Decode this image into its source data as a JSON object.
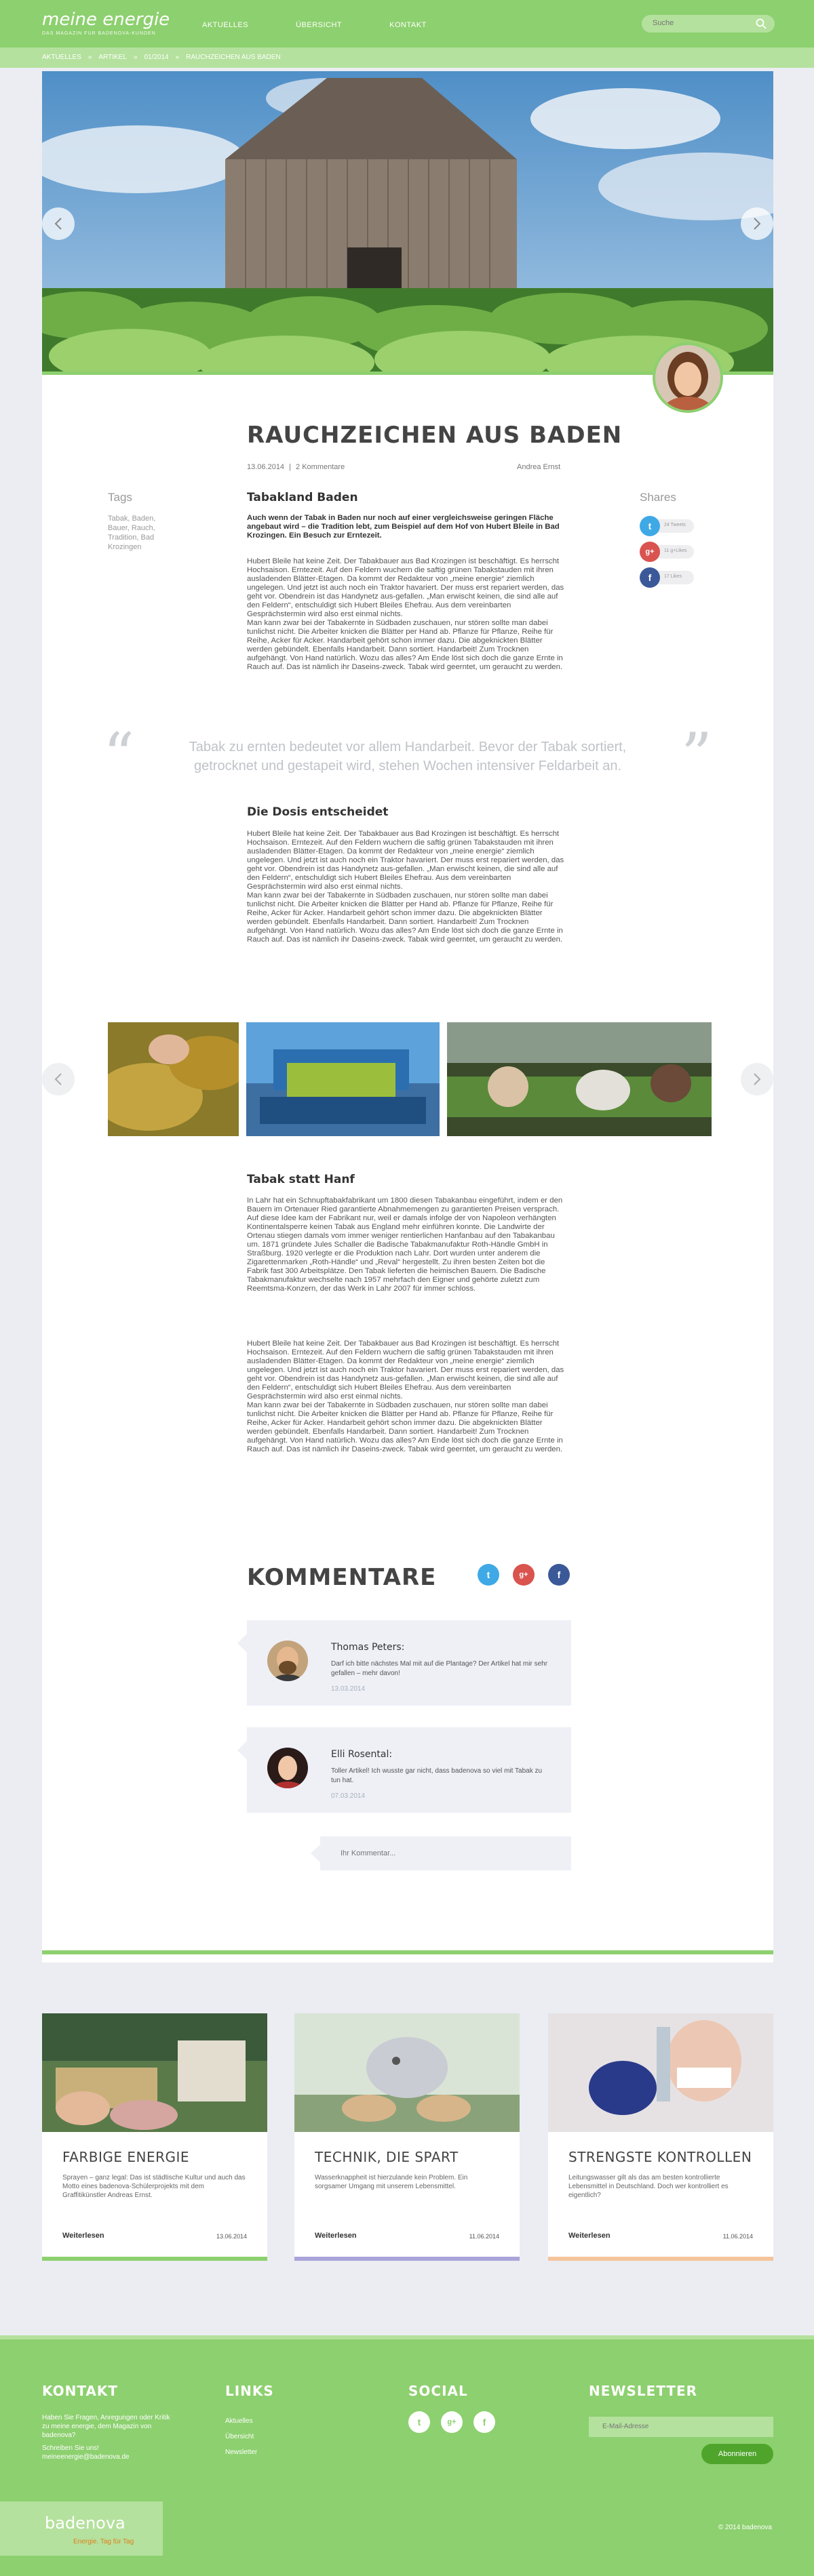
{
  "header": {
    "logo_name": "meine energie",
    "logo_tagline": "DAS MAGAZIN FÜR BADENOVA-KUNDEN",
    "nav": [
      "AKTUELLES",
      "ÜBERSICHT",
      "KONTAKT"
    ],
    "search_placeholder": "Suche"
  },
  "breadcrumb": [
    "AKTUELLES",
    "ARTIKEL",
    "01/2014",
    "RAUCHZEICHEN AUS BADEN"
  ],
  "breadcrumb_sep": "»",
  "article": {
    "title": "RAUCHZEICHEN AUS BADEN",
    "meta_date": "13.06.2014",
    "meta_sep": "|",
    "meta_comments": "2 Kommentare",
    "author": "Andrea Ernst",
    "tags_heading": "Tags",
    "tags": "Tabak, Baden, Bauer, Rauch, Tradition, Bad Krozingen",
    "shares_heading": "Shares",
    "shares": [
      {
        "network": "twitter-icon",
        "count": "24 Tweets",
        "color": "#3fa9e6",
        "glyph": "t"
      },
      {
        "network": "google-plus-icon",
        "count": "11 g+Likes",
        "color": "#d9534f",
        "glyph": "g+"
      },
      {
        "network": "facebook-icon",
        "count": "17 Likes",
        "color": "#3b5998",
        "glyph": "f"
      }
    ],
    "section1_heading": "Tabakland Baden",
    "lead": "Auch wenn der Tabak in Baden nur noch auf einer vergleichsweise geringen Fläche angebaut wird – die Tradition lebt, zum Beispiel auf dem Hof von Hubert Bleile in Bad Krozingen. Ein Besuch zur Erntezeit.",
    "body1": "Hubert Bleile hat keine Zeit. Der Tabakbauer aus Bad Krozingen ist beschäftigt. Es herrscht Hochsaison. Erntezeit. Auf den Feldern wuchern die saftig grünen Tabakstauden mit ihren ausladenden Blätter-Etagen. Da kommt der Redakteur von „meine energie“ ziemlich ungelegen. Und jetzt ist auch noch ein Traktor havariert. Der muss erst repariert werden, das geht vor. Obendrein ist das Handynetz aus-gefallen. „Man erwischt keinen, die sind alle auf den Feldern“, entschuldigt sich Hubert Bleiles Ehefrau. Aus dem vereinbarten Gesprächstermin wird also erst einmal nichts.\nMan kann zwar bei der Tabakernte in Südbaden zuschauen, nur stören sollte man dabei tunlichst nicht. Die Arbeiter knicken die Blätter per Hand ab. Pflanze für Pflanze, Reihe für Reihe, Acker für Acker. Handarbeit gehört schon immer dazu. Die abgeknickten Blätter werden gebündelt. Ebenfalls Handarbeit. Dann sortiert. Handarbeit! Zum Trocknen aufgehängt. Von Hand natürlich. Wozu das alles? Am Ende löst sich doch die ganze Ernte in Rauch auf. Das ist nämlich ihr Daseins-zweck. Tabak wird geerntet, um geraucht zu werden.",
    "quote": "Tabak zu ernten bedeutet vor allem Handarbeit. Bevor der Tabak sortiert, getrocknet und gestapeit wird, stehen Wochen intensiver Feldarbeit an.",
    "quote_open": "“",
    "quote_close": "”",
    "section2_heading": "Die Dosis entscheidet",
    "body2": "Hubert Bleile hat keine Zeit. Der Tabakbauer aus Bad Krozingen ist beschäftigt. Es herrscht Hochsaison. Erntezeit. Auf den Feldern wuchern die saftig grünen Tabakstauden mit ihren ausladenden Blätter-Etagen. Da kommt der Redakteur von „meine energie“ ziemlich ungelegen. Und jetzt ist auch noch ein Traktor havariert. Der muss erst repariert werden, das geht vor. Obendrein ist das Handynetz aus-gefallen. „Man erwischt keinen, die sind alle auf den Feldern“, entschuldigt sich Hubert Bleiles Ehefrau. Aus dem vereinbarten Gesprächstermin wird also erst einmal nichts.\nMan kann zwar bei der Tabakernte in Südbaden zuschauen, nur stören sollte man dabei tunlichst nicht. Die Arbeiter knicken die Blätter per Hand ab. Pflanze für Pflanze, Reihe für Reihe, Acker für Acker. Handarbeit gehört schon immer dazu. Die abgeknickten Blätter werden gebündelt. Ebenfalls Handarbeit. Dann sortiert. Handarbeit! Zum Trocknen aufgehängt. Von Hand natürlich. Wozu das alles? Am Ende löst sich doch die ganze Ernte in Rauch auf. Das ist nämlich ihr Daseins-zweck. Tabak wird geerntet, um geraucht zu werden.",
    "section3_heading": "Tabak statt Hanf",
    "body3": "In Lahr hat ein Schnupftabakfabrikant um 1800 diesen Tabakanbau eingeführt, indem er den Bauern im Ortenauer Ried garantierte Abnahmemengen zu garantierten Preisen versprach. Auf diese Idee kam der Fabrikant nur, weil er damals infolge der von Napoleon verhängten Kontinentalsperre keinen Tabak aus England mehr einführen konnte. Die Landwirte der Ortenau stiegen damals vom immer weniger rentierlichen Hanfanbau auf den Tabakanbau um. 1871 gründete Jules Schaller die Badische Tabakmanufaktur Roth-Händle GmbH in Straßburg. 1920 verlegte er die Produktion nach Lahr. Dort wurden unter anderem die Zigarettenmarken „Roth-Händle“ und „Reval“ hergestellt. Zu ihren besten Zeiten bot die Fabrik fast 300 Arbeitsplätze. Den Tabak lieferten die heimischen Bauern. Die Badische Tabakmanufaktur wechselte nach 1957 mehrfach den Eigner und gehörte zuletzt zum Reemtsma-Konzern, der das Werk in Lahr 2007 für immer schloss.",
    "body4": "Hubert Bleile hat keine Zeit. Der Tabakbauer aus Bad Krozingen ist beschäftigt. Es herrscht Hochsaison. Erntezeit. Auf den Feldern wuchern die saftig grünen Tabakstauden mit ihren ausladenden Blätter-Etagen. Da kommt der Redakteur von „meine energie“ ziemlich ungelegen. Und jetzt ist auch noch ein Traktor havariert. Der muss erst repariert werden, das geht vor. Obendrein ist das Handynetz aus-gefallen. „Man erwischt keinen, die sind alle auf den Feldern“, entschuldigt sich Hubert Bleiles Ehefrau. Aus dem vereinbarten Gesprächstermin wird also erst einmal nichts.\nMan kann zwar bei der Tabakernte in Südbaden zuschauen, nur stören sollte man dabei tunlichst nicht. Die Arbeiter knicken die Blätter per Hand ab. Pflanze für Pflanze, Reihe für Reihe, Acker für Acker. Handarbeit gehört schon immer dazu. Die abgeknickten Blätter werden gebündelt. Ebenfalls Handarbeit. Dann sortiert. Handarbeit! Zum Trocknen aufgehängt. Von Hand natürlich. Wozu das alles? Am Ende löst sich doch die ganze Ernte in Rauch auf. Das ist nämlich ihr Daseins-zweck. Tabak wird geerntet, um geraucht zu werden."
  },
  "comments": {
    "heading": "KOMMENTARE",
    "items": [
      {
        "name": "Thomas Peters:",
        "text": "Darf ich bitte nächstes Mal mit auf die Plantage? Der Artikel hat mir sehr gefallen – mehr davon!",
        "date": "13.03.2014"
      },
      {
        "name": "Elli Rosental:",
        "text": "Toller Artikel! Ich wusste gar nicht, dass badenova so viel mit Tabak zu tun hat.",
        "date": "07.03.2014"
      }
    ],
    "reply_placeholder": "Ihr Kommentar..."
  },
  "related": [
    {
      "title": "FARBIGE ENERGIE",
      "desc": "Sprayen – ganz legal: Das ist städtische Kultur und auch das Motto eines badenova-Schülerprojekts mit dem Graffitikünstler Andreas Ernst.",
      "more": "Weiterlesen",
      "date": "13.06.2014",
      "color": "#8dd06f"
    },
    {
      "title": "TECHNIK, DIE SPART",
      "desc": "Wasserknappheit ist hierzulande kein Problem. Ein sorgsamer Umgang mit unserem Lebensmittel.",
      "more": "Weiterlesen",
      "date": "11.06.2014",
      "color": "#a9a4d9"
    },
    {
      "title": "STRENGSTE KONTROLLEN",
      "desc": "Leitungswasser gilt als das am besten kontrollierte Lebensmittel in Deutschland. Doch wer kontrolliert es eigentlich?",
      "more": "Weiterlesen",
      "date": "11.06.2014",
      "color": "#f5c49a"
    }
  ],
  "footer": {
    "contact_h": "KONTAKT",
    "contact_text": "Haben Sie Fragen, Anregungen oder Kritik zu meine energie, dem Magazin von badenova?",
    "contact_write": "Schreiben Sie uns!",
    "contact_mail": "meineenergie@badenova.de",
    "links_h": "LINKS",
    "links": [
      "Aktuelles",
      "Übersicht",
      "Newsletter"
    ],
    "social_h": "SOCIAL",
    "social": [
      {
        "name": "twitter-icon",
        "glyph": "t"
      },
      {
        "name": "google-plus-icon",
        "glyph": "g+"
      },
      {
        "name": "facebook-icon",
        "glyph": "f"
      }
    ],
    "newsletter_h": "NEWSLETTER",
    "newsletter_placeholder": "E-Mail-Adresse",
    "newsletter_button": "Abonnieren",
    "brand": "badenova",
    "brand_slogan": "Energie. Tag für Tag",
    "copyright": "© 2014 badenova"
  }
}
